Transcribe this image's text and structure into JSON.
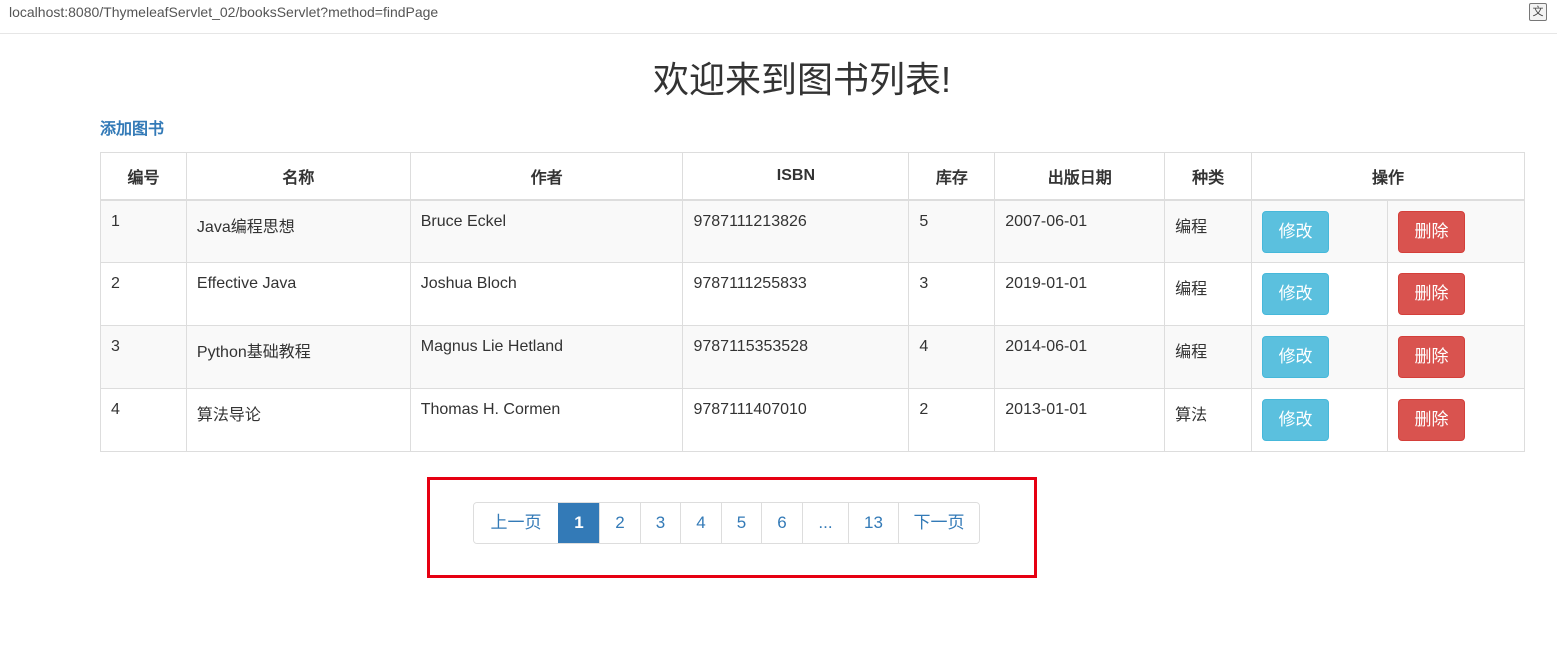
{
  "browser": {
    "url": "localhost:8080/ThymeleafServlet_02/booksServlet?method=findPage",
    "translate_icon": "translate-icon"
  },
  "page": {
    "title": "欢迎来到图书列表!",
    "add_link": "添加图书"
  },
  "table": {
    "headers": [
      "编号",
      "名称",
      "作者",
      "ISBN",
      "库存",
      "出版日期",
      "种类",
      "操作"
    ],
    "rows": [
      {
        "id": "1",
        "name": "Java编程思想",
        "author": "Bruce Eckel",
        "isbn": "9787111213826",
        "stock": "5",
        "date": "2007-06-01",
        "category": "编程",
        "edit": "修改",
        "delete": "删除"
      },
      {
        "id": "2",
        "name": "Effective Java",
        "author": "Joshua Bloch",
        "isbn": "9787111255833",
        "stock": "3",
        "date": "2019-01-01",
        "category": "编程",
        "edit": "修改",
        "delete": "删除"
      },
      {
        "id": "3",
        "name": "Python基础教程",
        "author": "Magnus Lie Hetland",
        "isbn": "9787115353528",
        "stock": "4",
        "date": "2014-06-01",
        "category": "编程",
        "edit": "修改",
        "delete": "删除"
      },
      {
        "id": "4",
        "name": "算法导论",
        "author": "Thomas H. Cormen",
        "isbn": "9787111407010",
        "stock": "2",
        "date": "2013-01-01",
        "category": "算法",
        "edit": "修改",
        "delete": "删除"
      }
    ]
  },
  "pagination": {
    "prev": "上一页",
    "pages": [
      "1",
      "2",
      "3",
      "4",
      "5",
      "6",
      "...",
      "13"
    ],
    "active": "1",
    "next": "下一页"
  },
  "colors": {
    "link": "#337ab7",
    "edit_button": "#5bc0de",
    "delete_button": "#d9534f",
    "highlight_box": "#e60012"
  }
}
